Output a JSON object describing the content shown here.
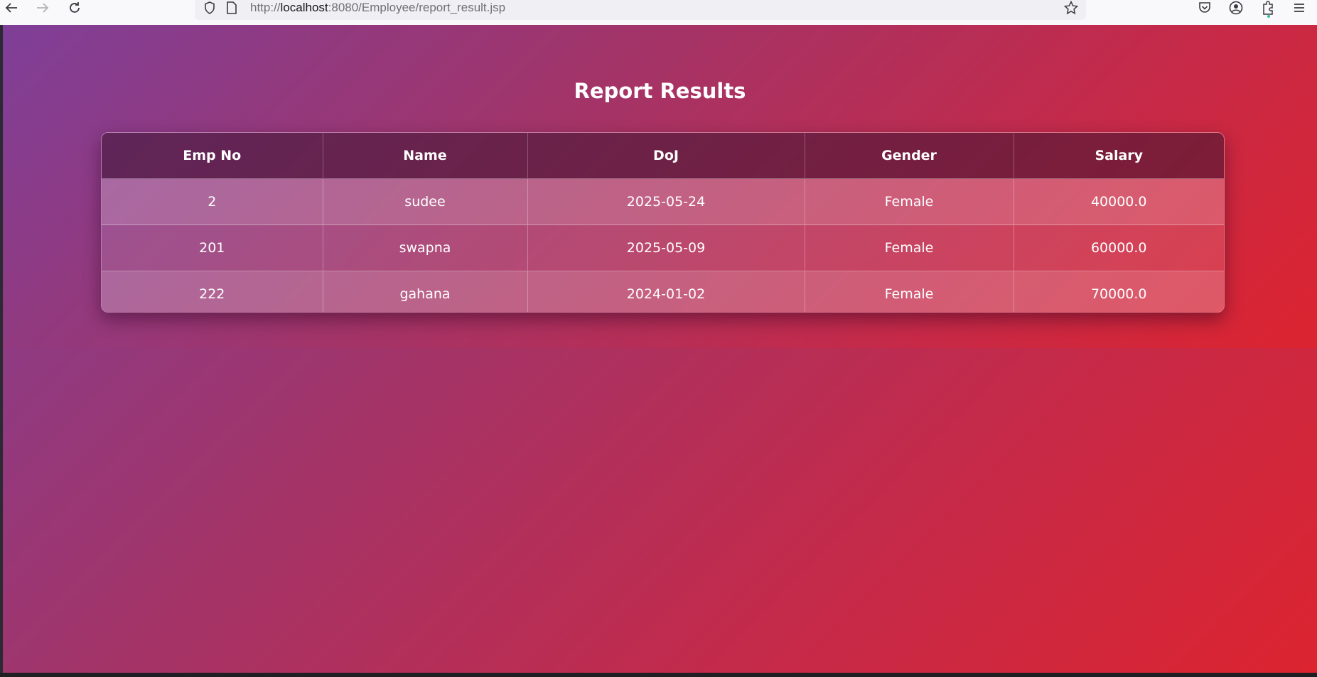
{
  "browser": {
    "url_scheme": "http://",
    "url_host": "localhost",
    "url_rest": ":8080/Employee/report_result.jsp",
    "icons": [
      "back-icon",
      "forward-icon",
      "reload-icon",
      "shield-icon",
      "page-icon",
      "star-icon",
      "pocket-icon",
      "account-icon",
      "extensions-icon",
      "menu-icon"
    ]
  },
  "page": {
    "title": "Report Results"
  },
  "table": {
    "headers": [
      "Emp No",
      "Name",
      "DoJ",
      "Gender",
      "Salary"
    ],
    "rows": [
      [
        "2",
        "sudee",
        "2025-05-24",
        "Female",
        "40000.0"
      ],
      [
        "201",
        "swapna",
        "2025-05-09",
        "Female",
        "60000.0"
      ],
      [
        "222",
        "gahana",
        "2024-01-02",
        "Female",
        "70000.0"
      ]
    ]
  },
  "colors": {
    "gradient_start": "#7f3f98",
    "gradient_end": "#dc2430",
    "text": "#ffffff"
  }
}
